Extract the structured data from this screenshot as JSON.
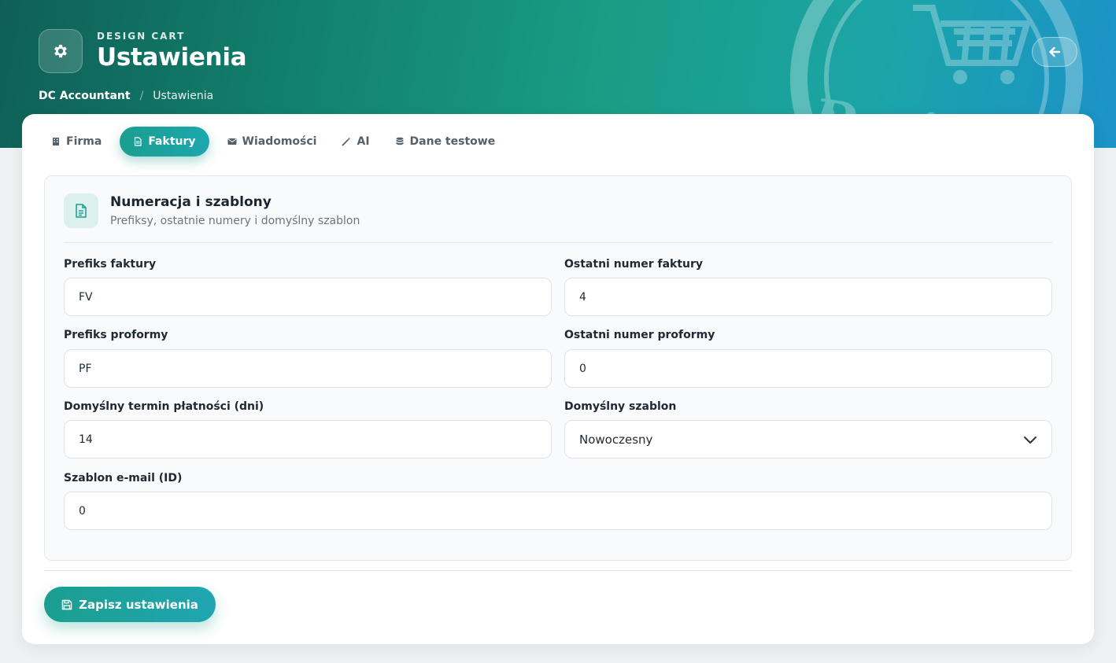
{
  "header": {
    "kicker": "DESIGN CART",
    "title": "Ustawienia",
    "app_icon": "gear-icon",
    "back_icon": "arrow-left-icon",
    "watermark_text": "Design Cart"
  },
  "breadcrumb": {
    "root": "DC Accountant",
    "separator": "/",
    "current": "Ustawienia"
  },
  "tabs": [
    {
      "label": "Firma",
      "icon": "building-icon",
      "active": false
    },
    {
      "label": "Faktury",
      "icon": "document-icon",
      "active": true
    },
    {
      "label": "Wiadomości",
      "icon": "envelope-icon",
      "active": false
    },
    {
      "label": "AI",
      "icon": "magic-wand-icon",
      "active": false
    },
    {
      "label": "Dane testowe",
      "icon": "database-icon",
      "active": false
    }
  ],
  "section": {
    "title": "Numeracja i szablony",
    "subtitle": "Prefiksy, ostatnie numery i domyślny szablon",
    "icon": "document-icon"
  },
  "fields": {
    "invoice_prefix": {
      "label": "Prefiks faktury",
      "value": "FV"
    },
    "last_invoice_number": {
      "label": "Ostatni numer faktury",
      "value": "4"
    },
    "proforma_prefix": {
      "label": "Prefiks proformy",
      "value": "PF"
    },
    "last_proforma_number": {
      "label": "Ostatni numer proformy",
      "value": "0"
    },
    "payment_term": {
      "label": "Domyślny termin płatności (dni)",
      "value": "14"
    },
    "default_template": {
      "label": "Domyślny szablon",
      "value": "Nowoczesny"
    },
    "email_template": {
      "label": "Szablon e-mail (ID)",
      "value": "0"
    }
  },
  "actions": {
    "save_label": "Zapisz ustawienia",
    "save_icon": "floppy-disk-icon"
  },
  "colors": {
    "accent": "#1b9e8f",
    "accent_alt": "#1da7ae",
    "hero_start": "#0f5f55",
    "hero_end": "#1b92c9"
  }
}
